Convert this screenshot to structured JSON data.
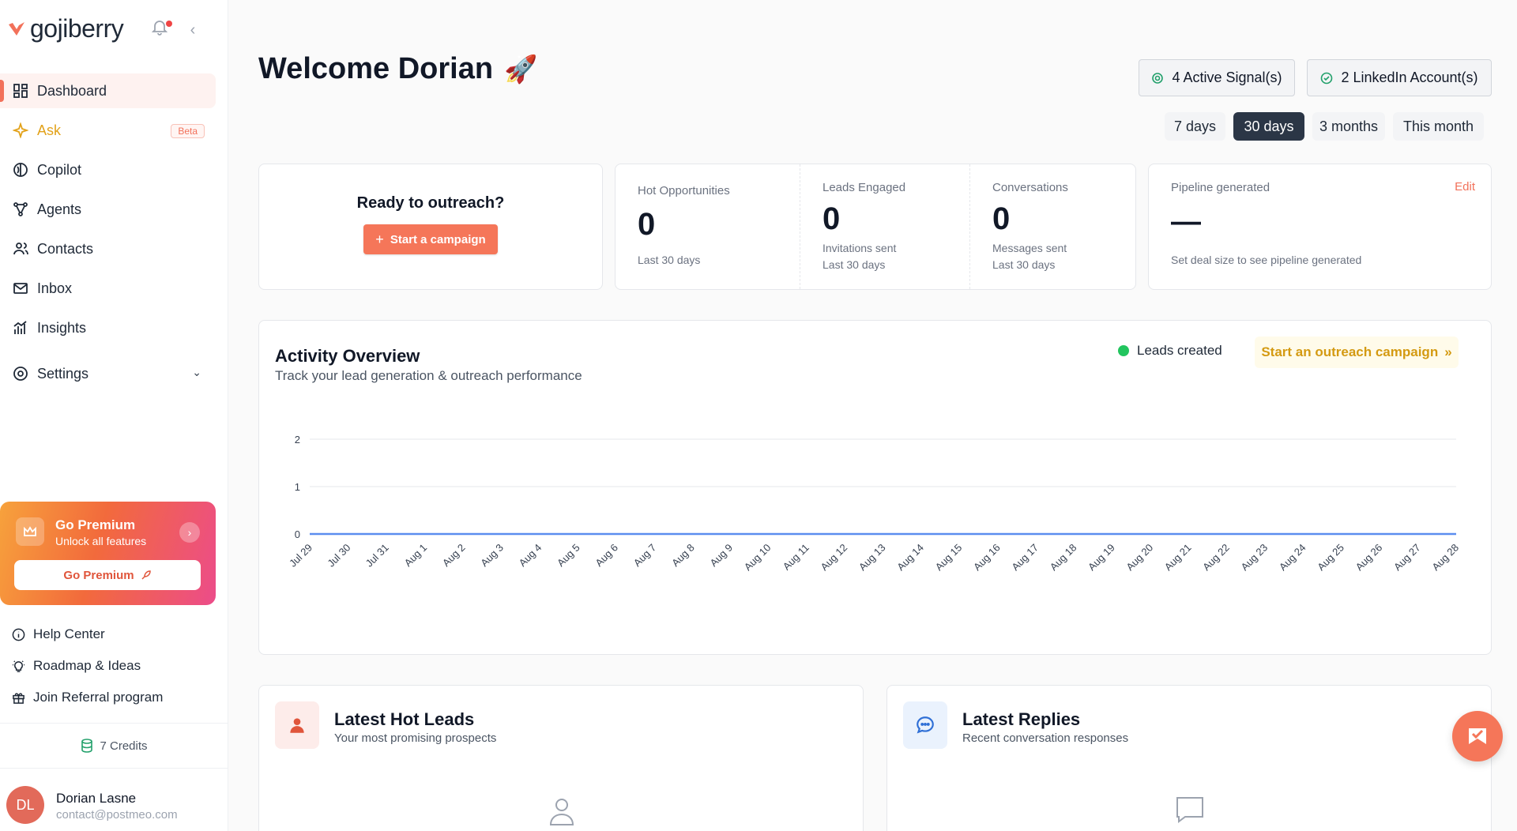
{
  "brand": {
    "name": "gojiberry",
    "accent": "#f2715a"
  },
  "sidebar": {
    "nav": [
      {
        "label": "Dashboard",
        "icon": "dashboard-icon"
      },
      {
        "label": "Ask",
        "badge": "Beta",
        "icon": "sparkle-icon"
      },
      {
        "label": "Copilot",
        "icon": "copilot-icon"
      },
      {
        "label": "Agents",
        "icon": "agents-icon"
      },
      {
        "label": "Contacts",
        "icon": "contacts-icon"
      },
      {
        "label": "Inbox",
        "icon": "inbox-icon"
      },
      {
        "label": "Insights",
        "icon": "insights-icon"
      },
      {
        "label": "Settings",
        "icon": "settings-icon"
      }
    ],
    "premium": {
      "title": "Go Premium",
      "subtitle": "Unlock all features",
      "button": "Go Premium"
    },
    "links": [
      {
        "label": "Help Center",
        "icon": "info-icon"
      },
      {
        "label": "Roadmap & Ideas",
        "icon": "lightbulb-icon"
      },
      {
        "label": "Join Referral program",
        "icon": "gift-icon"
      }
    ],
    "credits": "7 Credits",
    "user": {
      "initials": "DL",
      "name": "Dorian Lasne",
      "email": "contact@postmeo.com"
    }
  },
  "header": {
    "welcome": "Welcome Dorian",
    "emoji": "🚀",
    "signals": "4 Active Signal(s)",
    "linkedin": "2 LinkedIn Account(s)",
    "ranges": [
      "7 days",
      "30 days",
      "3 months",
      "This month"
    ],
    "selected_range": "30 days"
  },
  "outreach_card": {
    "title": "Ready to outreach?",
    "button": "Start a campaign"
  },
  "stats": {
    "hot": {
      "label": "Hot Opportunities",
      "value": "0",
      "sub": "Last 30 days"
    },
    "leads": {
      "label": "Leads Engaged",
      "value": "0",
      "sub1": "Invitations sent",
      "sub2": "Last 30 days"
    },
    "conv": {
      "label": "Conversations",
      "value": "0",
      "sub1": "Messages sent",
      "sub2": "Last 30 days"
    }
  },
  "pipeline": {
    "label": "Pipeline generated",
    "value": "—",
    "sub": "Set deal size to see pipeline generated",
    "edit": "Edit"
  },
  "activity": {
    "title": "Activity Overview",
    "subtitle": "Track your lead generation & outreach performance",
    "legend": "Leads created",
    "cta": "Start an outreach campaign"
  },
  "chart_data": {
    "type": "line",
    "categories": [
      "Jul 29",
      "Jul 30",
      "Jul 31",
      "Aug 1",
      "Aug 2",
      "Aug 3",
      "Aug 4",
      "Aug 5",
      "Aug 6",
      "Aug 7",
      "Aug 8",
      "Aug 9",
      "Aug 10",
      "Aug 11",
      "Aug 12",
      "Aug 13",
      "Aug 14",
      "Aug 15",
      "Aug 16",
      "Aug 17",
      "Aug 18",
      "Aug 19",
      "Aug 20",
      "Aug 21",
      "Aug 22",
      "Aug 23",
      "Aug 24",
      "Aug 25",
      "Aug 26",
      "Aug 27",
      "Aug 28"
    ],
    "series": [
      {
        "name": "Leads created",
        "values": [
          0,
          0,
          0,
          0,
          0,
          0,
          0,
          0,
          0,
          0,
          0,
          0,
          0,
          0,
          0,
          0,
          0,
          0,
          0,
          0,
          0,
          0,
          0,
          0,
          0,
          0,
          0,
          0,
          0,
          0,
          0
        ],
        "color": "#5b8def"
      }
    ],
    "yticks": [
      0,
      1,
      2
    ],
    "ylim": [
      0,
      2
    ],
    "grid": true
  },
  "hot_leads": {
    "title": "Latest Hot Leads",
    "subtitle": "Your most promising prospects"
  },
  "replies": {
    "title": "Latest Replies",
    "subtitle": "Recent conversation responses"
  }
}
